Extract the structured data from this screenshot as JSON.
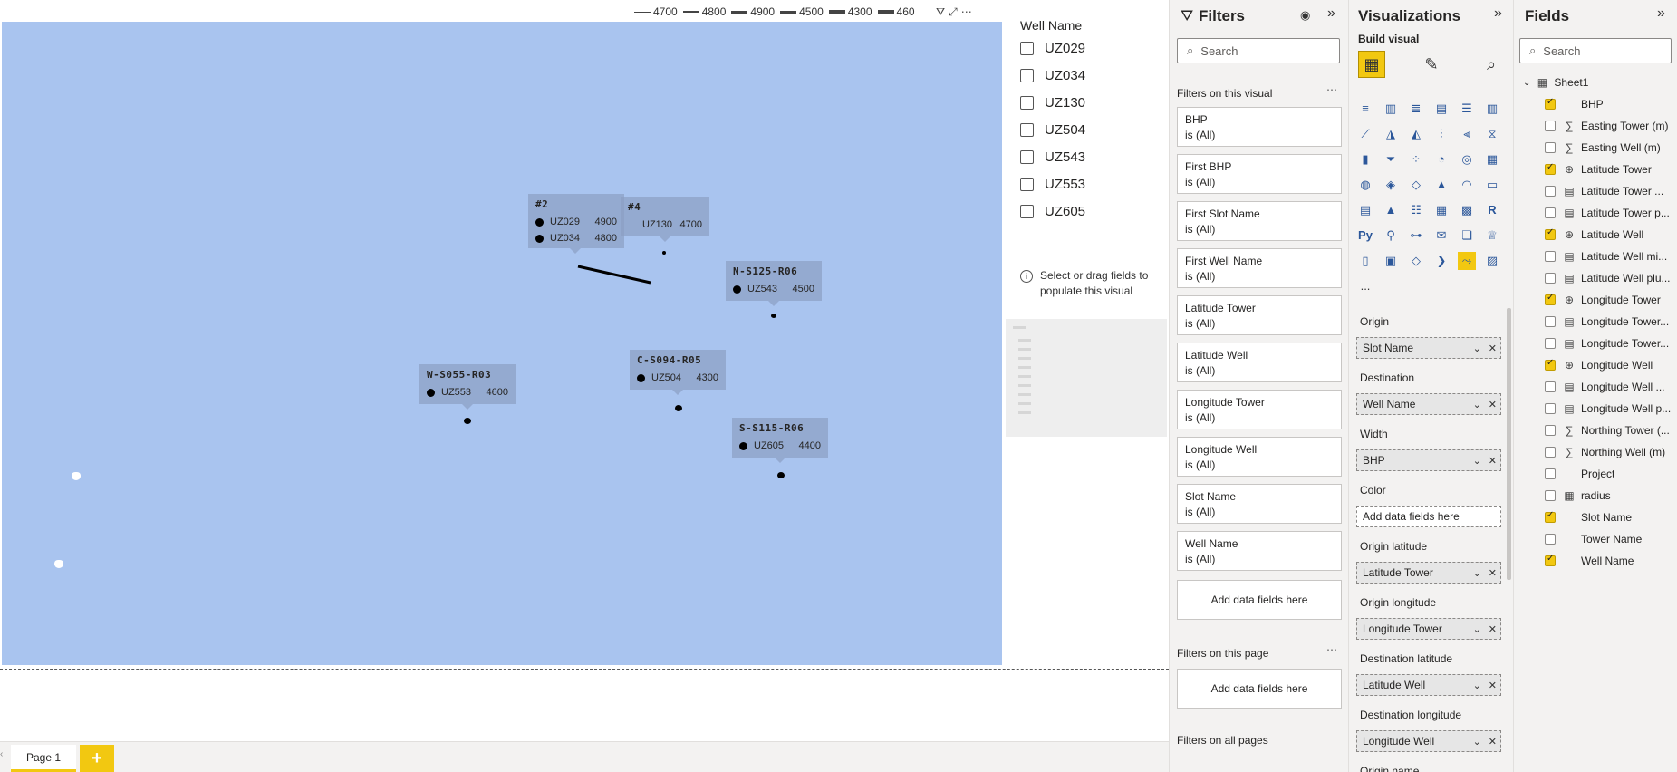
{
  "map": {
    "legend": [
      {
        "label": "4700",
        "weight": 1
      },
      {
        "label": "4800",
        "weight": 2
      },
      {
        "label": "4900",
        "weight": 3
      },
      {
        "label": "4500",
        "weight": 3
      },
      {
        "label": "4300",
        "weight": 4
      },
      {
        "label": "460",
        "weight": 4
      }
    ],
    "header_icons": [
      "filter-icon",
      "focus-mode-icon",
      "more-options-icon"
    ],
    "callouts": [
      {
        "title": "#2",
        "rows": [
          {
            "well": "UZ029",
            "bhp": "4900"
          },
          {
            "well": "UZ034",
            "bhp": "4800"
          }
        ]
      },
      {
        "title": "#4",
        "rows": [
          {
            "well": "UZ130",
            "bhp": "4700"
          }
        ]
      },
      {
        "title": "N-S125-R06",
        "rows": [
          {
            "well": "UZ543",
            "bhp": "4500"
          }
        ]
      },
      {
        "title": "W-S055-R03",
        "rows": [
          {
            "well": "UZ553",
            "bhp": "4600"
          }
        ]
      },
      {
        "title": "C-S094-R05",
        "rows": [
          {
            "well": "UZ504",
            "bhp": "4300"
          }
        ]
      },
      {
        "title": "S-S115-R06",
        "rows": [
          {
            "well": "UZ605",
            "bhp": "4400"
          }
        ]
      }
    ],
    "map_color": "#a9c4ef"
  },
  "slicer": {
    "title": "Well Name",
    "items": [
      "UZ029",
      "UZ034",
      "UZ130",
      "UZ504",
      "UZ543",
      "UZ553",
      "UZ605"
    ]
  },
  "empty_visual": {
    "message": "Select or drag fields to populate this visual"
  },
  "page_tabs": {
    "tabs": [
      "Page 1"
    ],
    "add_label": "+"
  },
  "filters": {
    "title": "Filters",
    "search_placeholder": "Search",
    "on_visual_label": "Filters on this visual",
    "cards": [
      {
        "name": "BHP",
        "state": "is (All)"
      },
      {
        "name": "First BHP",
        "state": "is (All)"
      },
      {
        "name": "First Slot Name",
        "state": "is (All)"
      },
      {
        "name": "First Well Name",
        "state": "is (All)"
      },
      {
        "name": "Latitude Tower",
        "state": "is (All)"
      },
      {
        "name": "Latitude Well",
        "state": "is (All)"
      },
      {
        "name": "Longitude Tower",
        "state": "is (All)"
      },
      {
        "name": "Longitude Well",
        "state": "is (All)"
      },
      {
        "name": "Slot Name",
        "state": "is (All)"
      },
      {
        "name": "Well Name",
        "state": "is (All)"
      }
    ],
    "add_fields_label": "Add data fields here",
    "on_page_label": "Filters on this page",
    "on_page_add": "Add data fields here",
    "on_all_pages_label": "Filters on all pages"
  },
  "visualizations": {
    "title": "Visualizations",
    "build_label": "Build visual",
    "wells": [
      {
        "label": "Origin",
        "value": "Slot Name"
      },
      {
        "label": "Destination",
        "value": "Well Name"
      },
      {
        "label": "Width",
        "value": "BHP"
      },
      {
        "label": "Color",
        "value": "",
        "placeholder": "Add data fields here"
      },
      {
        "label": "Origin latitude",
        "value": "Latitude Tower"
      },
      {
        "label": "Origin longitude",
        "value": "Longitude Tower"
      },
      {
        "label": "Destination latitude",
        "value": "Latitude Well"
      },
      {
        "label": "Destination longitude",
        "value": "Longitude Well"
      },
      {
        "label": "Origin name",
        "value": ""
      }
    ],
    "more_label": "..."
  },
  "fields": {
    "title": "Fields",
    "search_placeholder": "Search",
    "table_name": "Sheet1",
    "items": [
      {
        "name": "BHP",
        "checked": true,
        "icon": "none"
      },
      {
        "name": "Easting Tower (m)",
        "checked": false,
        "icon": "sum-icon"
      },
      {
        "name": "Easting Well (m)",
        "checked": false,
        "icon": "sum-icon"
      },
      {
        "name": "Latitude Tower",
        "checked": true,
        "icon": "globe-icon"
      },
      {
        "name": "Latitude Tower ...",
        "checked": false,
        "icon": "calc-icon"
      },
      {
        "name": "Latitude Tower p...",
        "checked": false,
        "icon": "calc-icon"
      },
      {
        "name": "Latitude Well",
        "checked": true,
        "icon": "globe-icon"
      },
      {
        "name": "Latitude Well mi...",
        "checked": false,
        "icon": "calc-icon"
      },
      {
        "name": "Latitude Well plu...",
        "checked": false,
        "icon": "calc-icon"
      },
      {
        "name": "Longitude Tower",
        "checked": true,
        "icon": "globe-icon"
      },
      {
        "name": "Longitude Tower...",
        "checked": false,
        "icon": "calc-icon"
      },
      {
        "name": "Longitude Tower...",
        "checked": false,
        "icon": "calc-icon"
      },
      {
        "name": "Longitude Well",
        "checked": true,
        "icon": "globe-icon"
      },
      {
        "name": "Longitude Well ...",
        "checked": false,
        "icon": "calc-icon"
      },
      {
        "name": "Longitude Well p...",
        "checked": false,
        "icon": "calc-icon"
      },
      {
        "name": "Northing Tower (...",
        "checked": false,
        "icon": "sum-icon"
      },
      {
        "name": "Northing Well (m)",
        "checked": false,
        "icon": "sum-icon"
      },
      {
        "name": "Project",
        "checked": false,
        "icon": "none"
      },
      {
        "name": "radius",
        "checked": false,
        "icon": "table-icon"
      },
      {
        "name": "Slot Name",
        "checked": true,
        "icon": "none"
      },
      {
        "name": "Tower Name",
        "checked": false,
        "icon": "none"
      },
      {
        "name": "Well Name",
        "checked": true,
        "icon": "none"
      }
    ]
  },
  "colors": {
    "accent": "#f2c811",
    "pane_bg": "#f3f2f1",
    "map": "#a9c4ef"
  }
}
